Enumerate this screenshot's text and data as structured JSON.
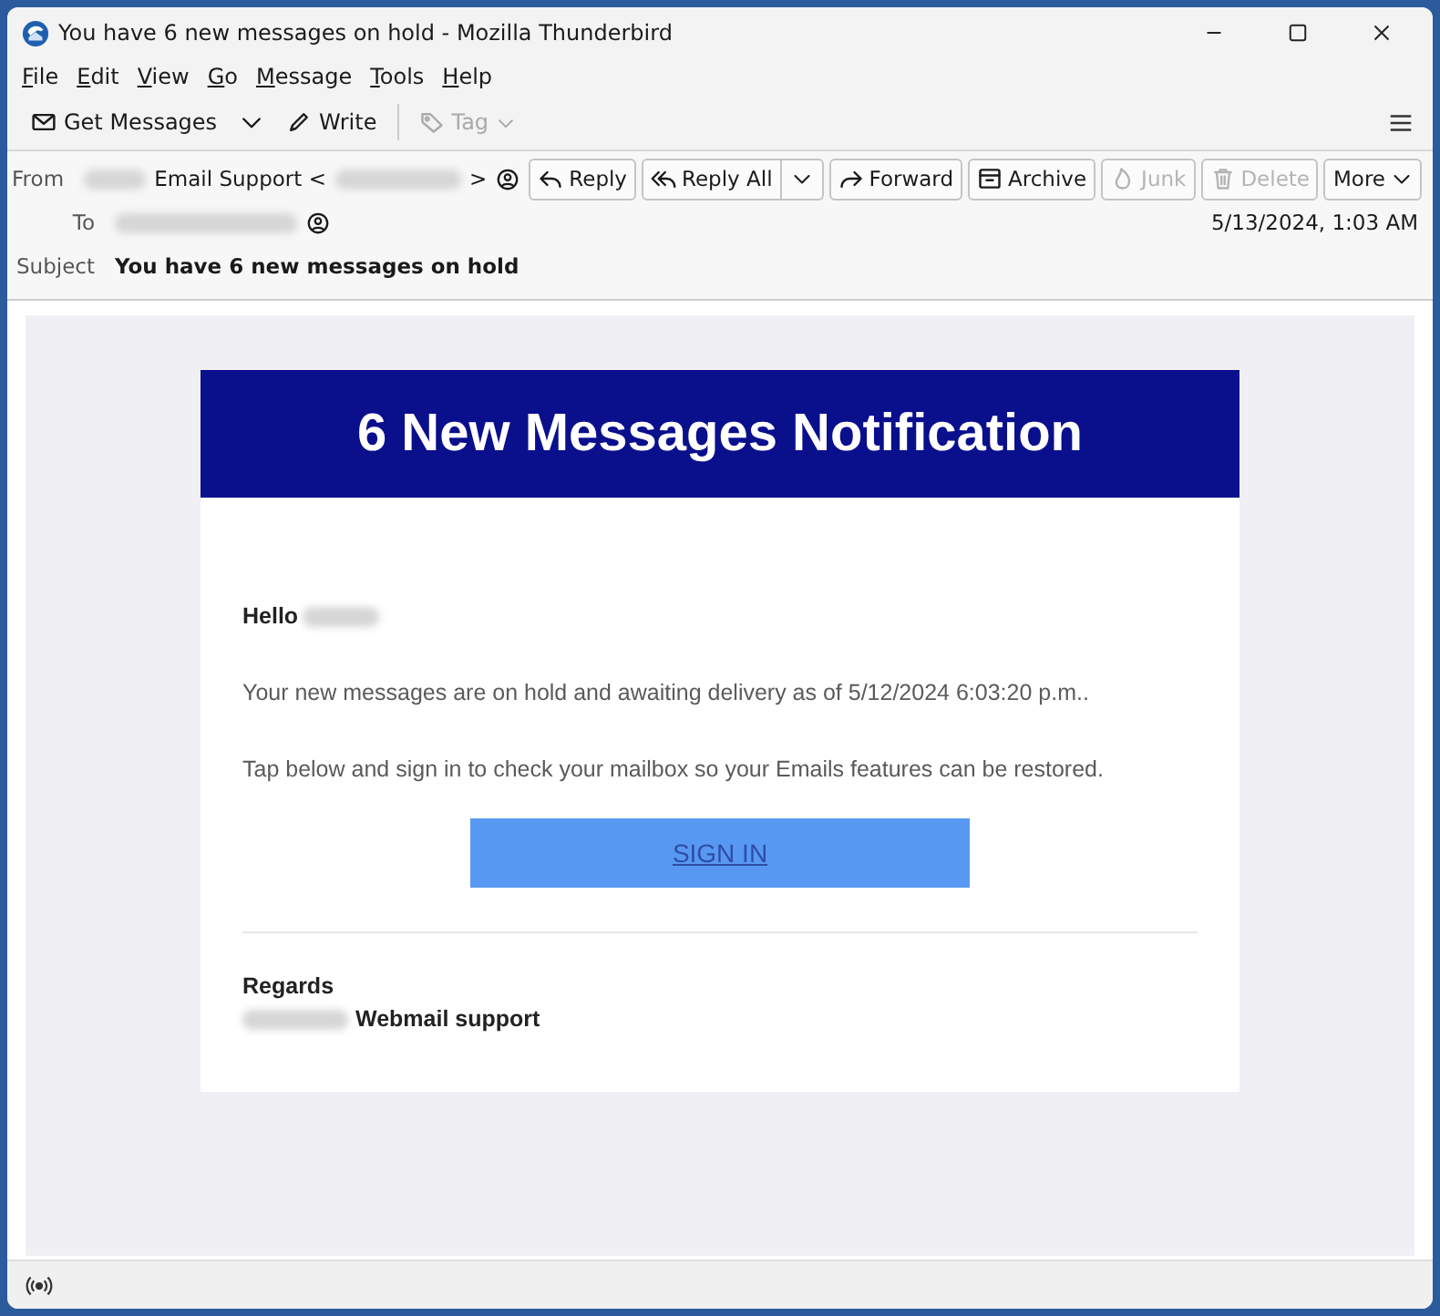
{
  "window": {
    "title": "You have 6 new messages on hold - Mozilla Thunderbird"
  },
  "menu": [
    {
      "label": "File"
    },
    {
      "label": "Edit"
    },
    {
      "label": "View"
    },
    {
      "label": "Go"
    },
    {
      "label": "Message"
    },
    {
      "label": "Tools"
    },
    {
      "label": "Help"
    }
  ],
  "toolbar": [
    {
      "label": "Get Messages",
      "kind": "mail",
      "disabled": false
    },
    {
      "kind": "dropdown",
      "disabled": false
    },
    {
      "label": "Write",
      "kind": "pen",
      "disabled": false
    },
    {
      "label": "Tag",
      "kind": "tag",
      "disabled": true
    }
  ],
  "header": {
    "from_label": "From",
    "from_name": "Email Support <",
    "from_end": ">",
    "to_label": "To",
    "subject_label": "Subject",
    "subject": "You have 6 new messages on hold",
    "date": "5/13/2024, 1:03 AM",
    "actions": [
      {
        "label": "Reply",
        "kind": "reply",
        "disabled": false
      },
      {
        "label": "Reply All",
        "kind": "replyall",
        "disabled": false
      },
      {
        "label": "Forward",
        "kind": "forward",
        "disabled": false
      },
      {
        "label": "Archive",
        "kind": "archive",
        "disabled": false
      },
      {
        "label": "Junk",
        "kind": "junk",
        "disabled": true
      },
      {
        "label": "Delete",
        "kind": "delete",
        "disabled": true
      },
      {
        "label": "More",
        "kind": "more",
        "disabled": false
      }
    ]
  },
  "message": {
    "banner": "6 New Messages Notification",
    "greeting": "Hello",
    "paragraphs": [
      "Your new messages are on hold and awaiting delivery as of 5/12/2024 6:03:20 p.m..",
      "Tap below and sign in to check your mailbox so your Emails features can be restored."
    ],
    "button": "SIGN IN",
    "closing": "Regards",
    "signature": "Webmail support"
  }
}
